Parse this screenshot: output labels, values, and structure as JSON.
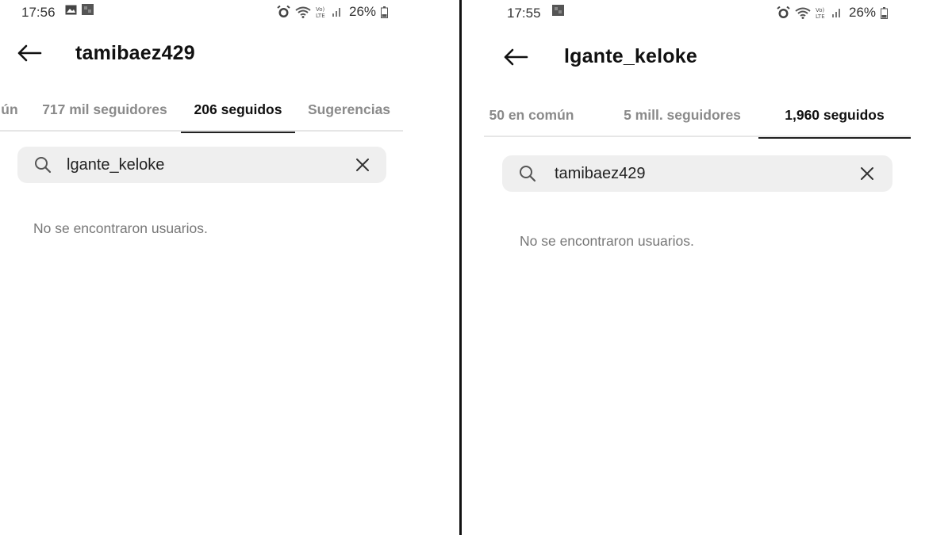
{
  "left": {
    "status": {
      "time": "17:56",
      "battery": "26%"
    },
    "title": "tamibaez429",
    "tabs": [
      {
        "label": "ún",
        "active": false
      },
      {
        "label": "717 mil seguidores",
        "active": false
      },
      {
        "label": "206 seguidos",
        "active": true
      },
      {
        "label": "Sugerencias",
        "active": false
      }
    ],
    "search": {
      "value": "lgante_keloke"
    },
    "empty_message": "No se encontraron usuarios."
  },
  "right": {
    "status": {
      "time": "17:55",
      "battery": "26%"
    },
    "title": "lgante_keloke",
    "tabs": [
      {
        "label": "50 en común",
        "active": false
      },
      {
        "label": "5 mill. seguidores",
        "active": false
      },
      {
        "label": "1,960 seguidos",
        "active": true
      }
    ],
    "search": {
      "value": "tamibaez429"
    },
    "empty_message": "No se encontraron usuarios."
  },
  "icons": {
    "back": "arrow-left-icon",
    "search": "search-icon",
    "clear": "close-icon",
    "alarm": "alarm-icon",
    "wifi": "wifi-icon",
    "volte": "volte-icon",
    "signal": "signal-icon",
    "battery": "battery-icon",
    "gallery": "gallery-icon",
    "notification": "notification-icon"
  },
  "colors": {
    "active_tab": "#111111",
    "inactive_tab": "#8a8a8a",
    "search_bg": "#efefef",
    "empty_text": "#777777"
  }
}
